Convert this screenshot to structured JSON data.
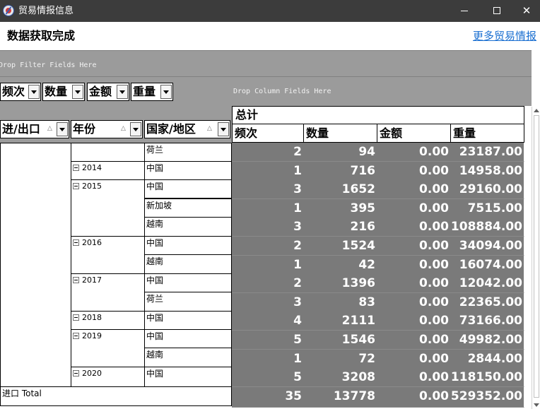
{
  "window": {
    "title": "贸易情报信息",
    "minimize": "",
    "maximize": "",
    "close": "✕"
  },
  "header": {
    "status": "数据获取完成",
    "more_link": "更多贸易情报"
  },
  "pivot": {
    "filter_hint": "Drop Filter Fields Here",
    "column_hint": "Drop Column Fields Here",
    "data_fields": [
      "频次",
      "数量",
      "金额",
      "重量"
    ],
    "row_fields": [
      "进/出口",
      "年份",
      "国家/地区"
    ],
    "sort_indicator": "△",
    "grand_total_header": "总计",
    "value_headers": [
      "频次",
      "数量",
      "金额",
      "重量"
    ],
    "rows": [
      {
        "year": "",
        "country": "荷兰",
        "values": [
          "2",
          "94",
          "0.00",
          "23187.00"
        ]
      },
      {
        "year": "2014",
        "country": "中国",
        "values": [
          "1",
          "716",
          "0.00",
          "14958.00"
        ]
      },
      {
        "year": "2015",
        "country": "中国",
        "values": [
          "3",
          "1652",
          "0.00",
          "29160.00"
        ]
      },
      {
        "year": "",
        "country": "新加坡",
        "values": [
          "1",
          "395",
          "0.00",
          "7515.00"
        ]
      },
      {
        "year": "",
        "country": "越南",
        "values": [
          "3",
          "216",
          "0.00",
          "108884.00"
        ]
      },
      {
        "year": "2016",
        "country": "中国",
        "values": [
          "2",
          "1524",
          "0.00",
          "34094.00"
        ]
      },
      {
        "year": "",
        "country": "越南",
        "values": [
          "1",
          "42",
          "0.00",
          "16074.00"
        ]
      },
      {
        "year": "2017",
        "country": "中国",
        "values": [
          "2",
          "1396",
          "0.00",
          "12042.00"
        ]
      },
      {
        "year": "",
        "country": "荷兰",
        "values": [
          "3",
          "83",
          "0.00",
          "22365.00"
        ]
      },
      {
        "year": "2018",
        "country": "中国",
        "values": [
          "4",
          "2111",
          "0.00",
          "73166.00"
        ]
      },
      {
        "year": "2019",
        "country": "中国",
        "values": [
          "5",
          "1546",
          "0.00",
          "49982.00"
        ]
      },
      {
        "year": "",
        "country": "越南",
        "values": [
          "1",
          "72",
          "0.00",
          "2844.00"
        ]
      },
      {
        "year": "2020",
        "country": "中国",
        "values": [
          "5",
          "3208",
          "0.00",
          "118150.00"
        ]
      }
    ],
    "total_row": {
      "label": "进口 Total",
      "values": [
        "35",
        "13778",
        "0.00",
        "529352.00"
      ]
    }
  }
}
